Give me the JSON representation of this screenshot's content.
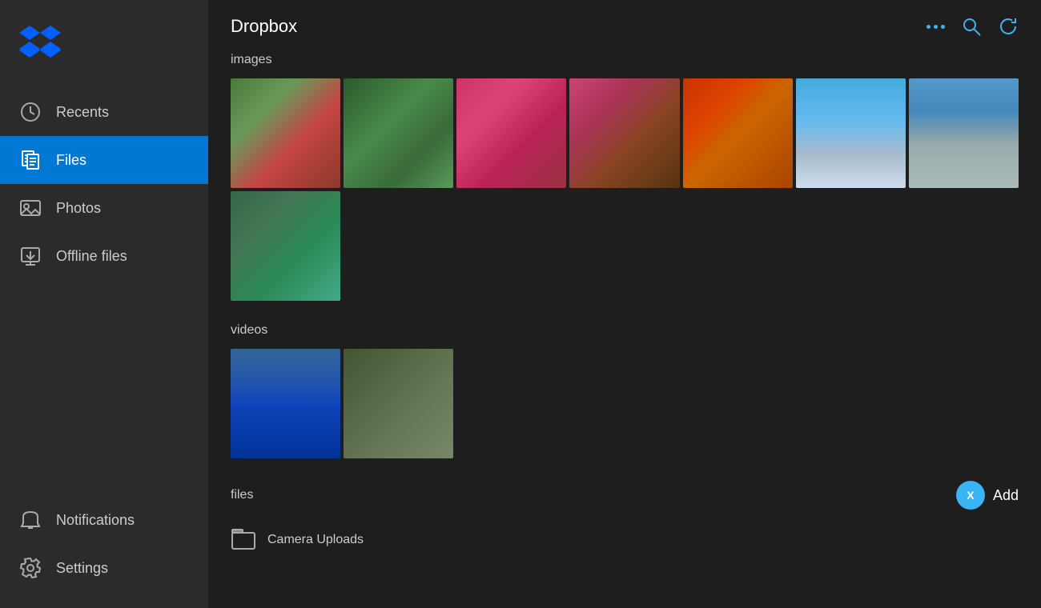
{
  "app": {
    "title": "Dropbox"
  },
  "sidebar": {
    "logo_alt": "Dropbox Logo",
    "items": [
      {
        "id": "recents",
        "label": "Recents",
        "icon": "clock-icon",
        "active": false
      },
      {
        "id": "files",
        "label": "Files",
        "icon": "files-icon",
        "active": true
      },
      {
        "id": "photos",
        "label": "Photos",
        "icon": "photos-icon",
        "active": false
      },
      {
        "id": "offline-files",
        "label": "Offline files",
        "icon": "offline-icon",
        "active": false
      }
    ],
    "bottom_items": [
      {
        "id": "notifications",
        "label": "Notifications",
        "icon": "notifications-icon",
        "active": false
      },
      {
        "id": "settings",
        "label": "Settings",
        "icon": "settings-icon",
        "active": false
      }
    ]
  },
  "header": {
    "title": "Dropbox",
    "more_label": "...",
    "search_label": "Search",
    "refresh_label": "Refresh"
  },
  "sections": {
    "images_label": "images",
    "videos_label": "videos",
    "files_label": "files"
  },
  "files_section": {
    "add_label": "Add",
    "add_x_label": "X",
    "camera_uploads_label": "Camera Uploads"
  }
}
